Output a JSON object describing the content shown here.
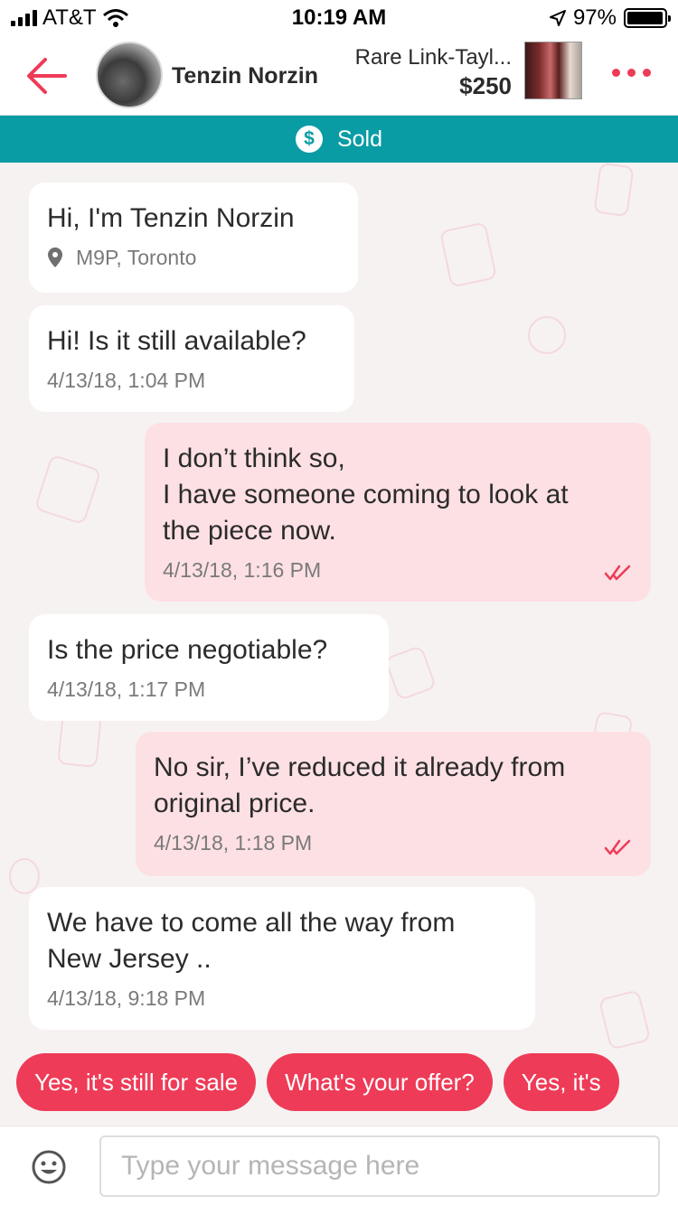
{
  "status_bar": {
    "carrier": "AT&T",
    "time": "10:19 AM",
    "battery": "97%",
    "battery_level": 0.97
  },
  "header": {
    "seller_name": "Tenzin Norzin",
    "item_title": "Rare Link-Tayl...",
    "item_price": "$250",
    "accent_color": "#ee3b57"
  },
  "banner": {
    "label": "Sold",
    "icon": "dollar-icon",
    "color": "#0a9ca5"
  },
  "messages": [
    {
      "text_lines": [
        "Hi, I'm Tenzin Norzin"
      ],
      "location": "M9P, Toronto",
      "direction": "in"
    },
    {
      "text_lines": [
        "Hi! Is it still available?"
      ],
      "timestamp": "4/13/18, 1:04 PM",
      "direction": "in"
    },
    {
      "text_lines": [
        "I don’t think so,",
        "I have someone coming to look at",
        "the piece now."
      ],
      "timestamp": "4/13/18, 1:16 PM",
      "direction": "out",
      "read": true
    },
    {
      "text_lines": [
        "Is the price negotiable?"
      ],
      "timestamp": "4/13/18, 1:17 PM",
      "direction": "in"
    },
    {
      "text_lines": [
        "No sir, I’ve reduced it already from",
        "original price."
      ],
      "timestamp": "4/13/18, 1:18 PM",
      "direction": "out",
      "read": true
    },
    {
      "text_lines": [
        "We have to come all the way from",
        "New Jersey .."
      ],
      "timestamp": "4/13/18, 9:18 PM",
      "direction": "in"
    }
  ],
  "quick_replies": [
    "Yes, it's still for sale",
    "What's your offer?",
    "Yes, it's"
  ],
  "composer": {
    "placeholder": "Type your message here"
  }
}
